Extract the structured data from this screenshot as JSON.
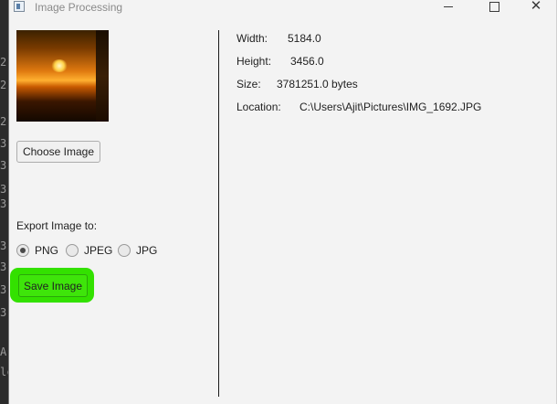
{
  "window": {
    "title": "Image Processing",
    "controls": {
      "minimize": "–",
      "maximize": "□",
      "close": "✕"
    }
  },
  "background_glyphs": [
    "2",
    "2",
    "2",
    "3",
    "3",
    "3",
    "3",
    "3",
    "3",
    "3",
    "3",
    "A",
    "lc"
  ],
  "image_panel": {
    "choose_button": "Choose Image",
    "export_label": "Export Image to:",
    "formats": [
      {
        "label": "PNG",
        "selected": true
      },
      {
        "label": "JPEG",
        "selected": false
      },
      {
        "label": "JPG",
        "selected": false
      }
    ],
    "save_button": "Save Image",
    "highlight_color": "#33e100"
  },
  "info": {
    "width_label": "Width:",
    "width_value": "5184.0",
    "height_label": "Height:",
    "height_value": "3456.0",
    "size_label": "Size:",
    "size_value": "3781251.0 bytes",
    "location_label": "Location:",
    "location_value": "C:\\Users\\Ajit\\Pictures\\IMG_1692.JPG"
  }
}
